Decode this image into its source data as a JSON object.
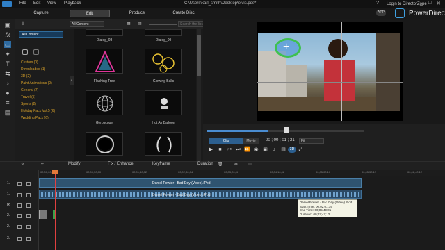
{
  "menu": {
    "file": "File",
    "edit": "Edit",
    "view": "View",
    "playback": "Playback"
  },
  "document": {
    "title": "C:\\Users\\karl_smith\\Desktop\\elvis.pds*"
  },
  "window": {
    "help": "?",
    "minimize": "_",
    "maximize": "□",
    "close": "✕"
  },
  "header": {
    "dz_link": "Login to DirectorZone",
    "app_badge": "APP",
    "brand": "PowerDirector"
  },
  "tabs": [
    "Capture",
    "Edit",
    "Produce",
    "Create Disc"
  ],
  "library": {
    "filter": "All Content",
    "search_placeholder": "Search the library",
    "categories": [
      "All Content",
      "Custom  (0)",
      "Downloaded  (1)",
      "3D  (2)",
      "Paint Animations  (0)",
      "General  (7)",
      "Travel  (5)",
      "Sports  (2)",
      "Holiday Pack Vol.5  (6)",
      "Wedding Pack  (6)"
    ],
    "items": [
      {
        "label": "Dialog_08"
      },
      {
        "label": "Dialog_09"
      },
      {
        "label": "Flashing Tree"
      },
      {
        "label": "Glowing Balls"
      },
      {
        "label": "Gyroscope"
      },
      {
        "label": "Hot Air Balloon"
      },
      {
        "label": ""
      },
      {
        "label": ""
      }
    ]
  },
  "player": {
    "mode_clip": "Clip",
    "mode_movie": "Movie",
    "timecode": "00 ; 00 ; 01 ; 21",
    "fit": "Fit",
    "badge_3d": "3D",
    "progress": 0.39
  },
  "timeline": {
    "toolbar": {
      "modify": "Modify",
      "fix_enhance": "Fix / Enhance",
      "keyframe": "Keyframe",
      "duration": "Duration"
    },
    "ticks": [
      "00;00;00;00",
      "00;00;50;00",
      "00;01;40;02",
      "00;02;30;04",
      "00;03;20;06",
      "00;04;10;08",
      "00;05;00;10",
      "00;05;50;12",
      "00;06;40;12"
    ],
    "tracks": [
      "1.",
      "1.",
      "fx",
      "2.",
      "2.",
      "3."
    ],
    "clip_label_video": "Daniel Powter - Bad Day (Video).iPod",
    "clip_label_audio": "Daniel Powter - Bad Day (Video).iPod",
    "tooltip": {
      "line1": "Daniel Powter - Bad Day (Video).iPod",
      "line2": "Start Time: 00;02;01;19",
      "line3": "End Time: 00;05;49;01",
      "line4": "Duration: 00;03;47;12"
    }
  }
}
